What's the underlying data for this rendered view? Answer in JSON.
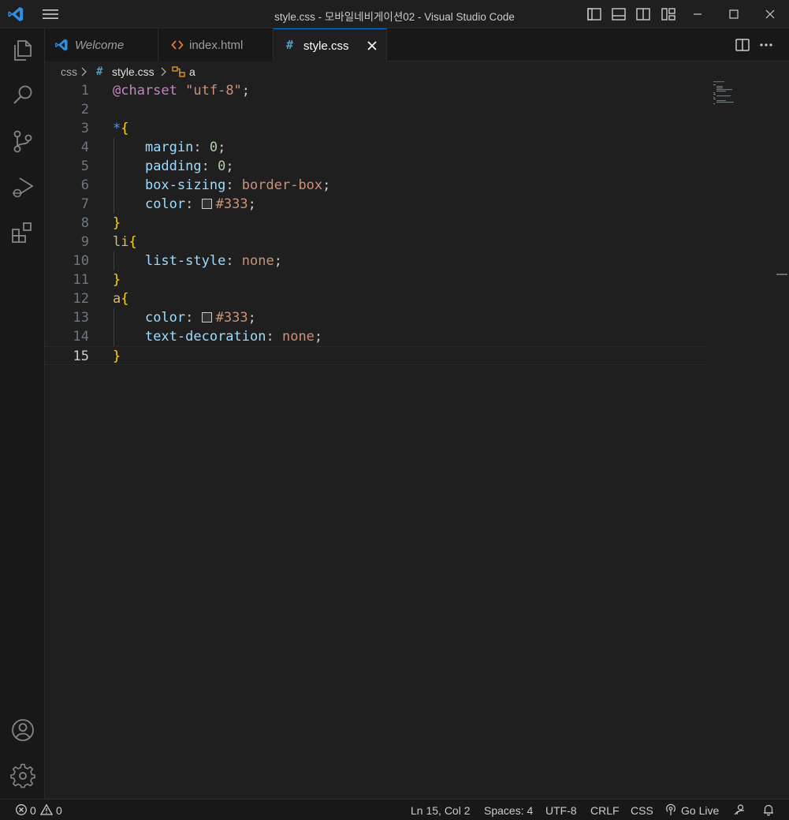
{
  "window": {
    "title": "style.css - 모바일네비게이션02 - Visual Studio Code"
  },
  "tabs": [
    {
      "label": "Welcome",
      "icon": "vscode-icon",
      "active": false
    },
    {
      "label": "index.html",
      "icon": "html-icon",
      "active": false
    },
    {
      "label": "style.css",
      "icon": "css-hash-icon",
      "active": true
    }
  ],
  "breadcrumb": {
    "folder": "css",
    "file": "style.css",
    "symbol": "a"
  },
  "editor": {
    "language": "css",
    "current_line": 15,
    "line_numbers": [
      "1",
      "2",
      "3",
      "4",
      "5",
      "6",
      "7",
      "8",
      "9",
      "10",
      "11",
      "12",
      "13",
      "14",
      "15"
    ],
    "colors": {
      "keyword": "#c586c0",
      "string": "#ce9178",
      "selector": "#d7ba7d",
      "brace": "#ffd700",
      "property": "#9cdcfe",
      "number": "#b5cea8"
    },
    "lines": {
      "l1_at": "@charset",
      "l1_str": "\"utf-8\"",
      "l1_end": ";",
      "l3_sel": "*",
      "l3_brace": "{",
      "l4_prop": "margin",
      "l4_colon": ": ",
      "l4_val": "0",
      "l4_end": ";",
      "l5_prop": "padding",
      "l5_colon": ": ",
      "l5_val": "0",
      "l5_end": ";",
      "l6_prop": "box-sizing",
      "l6_colon": ": ",
      "l6_val": "border-box",
      "l6_end": ";",
      "l7_prop": "color",
      "l7_colon": ": ",
      "l7_val": "#333",
      "l7_end": ";",
      "l8_brace": "}",
      "l9_sel": "li",
      "l9_brace": "{",
      "l10_prop": "list-style",
      "l10_colon": ": ",
      "l10_val": "none",
      "l10_end": ";",
      "l11_brace": "}",
      "l12_sel": "a",
      "l12_brace": "{",
      "l13_prop": "color",
      "l13_colon": ": ",
      "l13_val": "#333",
      "l13_end": ";",
      "l14_prop": "text-decoration",
      "l14_colon": ": ",
      "l14_val": "none",
      "l14_end": ";",
      "l15_brace": "}"
    }
  },
  "statusbar": {
    "errors": "0",
    "warnings": "0",
    "position": "Ln 15, Col 2",
    "spaces": "Spaces: 4",
    "encoding": "UTF-8",
    "eol": "CRLF",
    "language": "CSS",
    "golive": "Go Live"
  },
  "theme": {
    "accent": "#0078d4",
    "background": "#1f1f1f"
  }
}
